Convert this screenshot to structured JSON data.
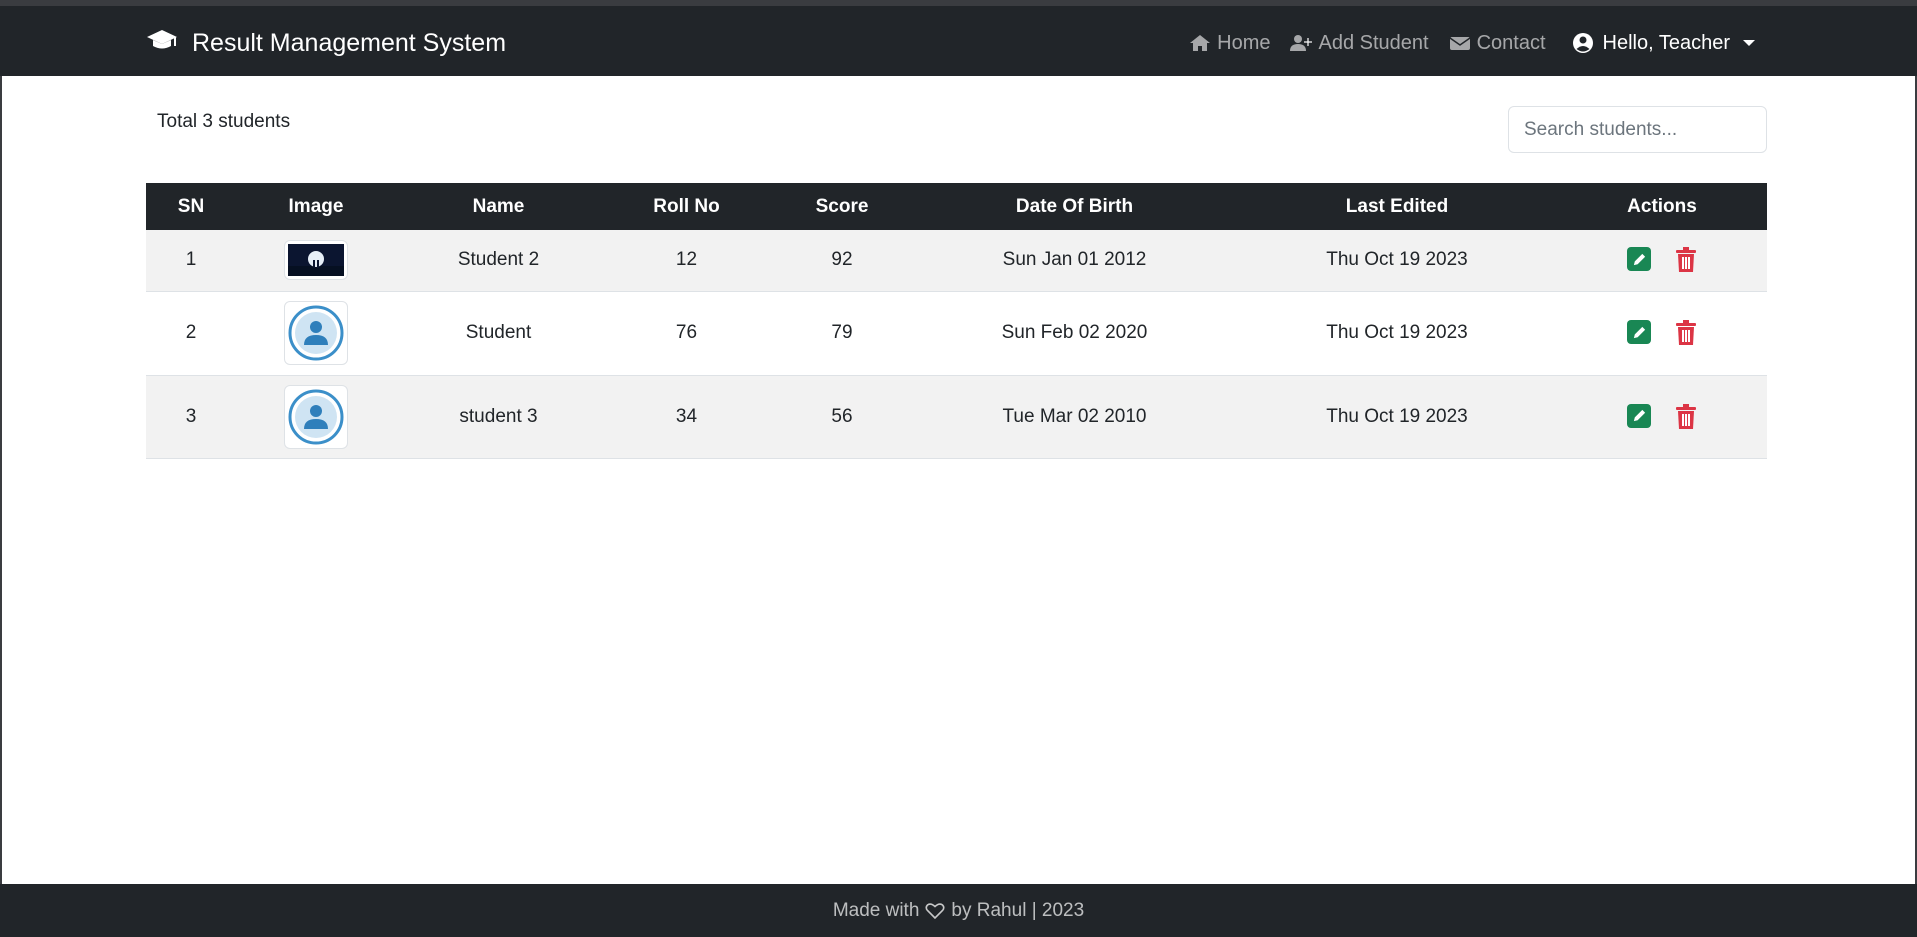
{
  "navbar": {
    "brand": "Result Management System",
    "links": [
      {
        "label": "Home",
        "icon": "home-icon"
      },
      {
        "label": "Add Student",
        "icon": "user-plus-icon"
      },
      {
        "label": "Contact",
        "icon": "envelope-icon"
      }
    ],
    "user_label": "Hello, Teacher"
  },
  "summary": {
    "total_text": "Total 3 students"
  },
  "search": {
    "placeholder": "Search students..."
  },
  "table": {
    "headers": [
      "SN",
      "Image",
      "Name",
      "Roll No",
      "Score",
      "Date Of Birth",
      "Last Edited",
      "Actions"
    ],
    "rows": [
      {
        "sn": "1",
        "image": "landscape-photo",
        "name": "Student 2",
        "roll": "12",
        "score": "92",
        "dob": "Sun Jan 01 2012",
        "edited": "Thu Oct 19 2023"
      },
      {
        "sn": "2",
        "image": "default-avatar",
        "name": "Student",
        "roll": "76",
        "score": "79",
        "dob": "Sun Feb 02 2020",
        "edited": "Thu Oct 19 2023"
      },
      {
        "sn": "3",
        "image": "default-avatar",
        "name": "student 3",
        "roll": "34",
        "score": "56",
        "dob": "Tue Mar 02 2010",
        "edited": "Thu Oct 19 2023"
      }
    ]
  },
  "footer": {
    "prefix": "Made with",
    "suffix": "by Rahul | 2023"
  },
  "colors": {
    "navbar_bg": "#212529",
    "edit_green": "#198754",
    "delete_red": "#dc3545",
    "avatar_blue": "#3b8fc9"
  }
}
